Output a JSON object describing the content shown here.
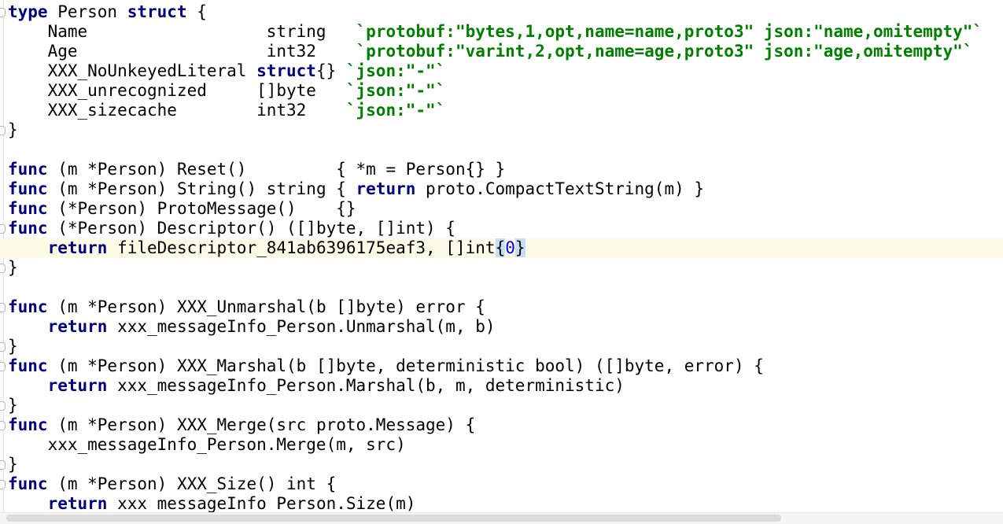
{
  "lines": [
    [
      {
        "t": "type",
        "c": "kw"
      },
      {
        "t": " Person "
      },
      {
        "t": "struct",
        "c": "kw"
      },
      {
        "t": " {"
      }
    ],
    [
      {
        "t": "    Name                  string   "
      },
      {
        "t": "`protobuf:\"bytes,1,opt,name=name,proto3\" json:\"name,omitempty\"`",
        "c": "str"
      }
    ],
    [
      {
        "t": "    Age                   int32    "
      },
      {
        "t": "`protobuf:\"varint,2,opt,name=age,proto3\" json:\"age,omitempty\"`",
        "c": "str"
      }
    ],
    [
      {
        "t": "    XXX_NoUnkeyedLiteral "
      },
      {
        "t": "struct",
        "c": "kw"
      },
      {
        "t": "{} "
      },
      {
        "t": "`json:\"-\"`",
        "c": "str"
      }
    ],
    [
      {
        "t": "    XXX_unrecognized     []byte   "
      },
      {
        "t": "`json:\"-\"`",
        "c": "str"
      }
    ],
    [
      {
        "t": "    XXX_sizecache        int32    "
      },
      {
        "t": "`json:\"-\"`",
        "c": "str"
      }
    ],
    [
      {
        "t": "}"
      }
    ],
    [],
    [
      {
        "t": "func",
        "c": "kw"
      },
      {
        "t": " (m *Person) Reset()         { *m = Person{} }"
      }
    ],
    [
      {
        "t": "func",
        "c": "kw"
      },
      {
        "t": " (m *Person) String() string { "
      },
      {
        "t": "return",
        "c": "kw"
      },
      {
        "t": " proto.CompactTextString(m) }"
      }
    ],
    [
      {
        "t": "func",
        "c": "kw"
      },
      {
        "t": " (*Person) ProtoMessage()    {}"
      }
    ],
    [
      {
        "t": "func",
        "c": "kw"
      },
      {
        "t": " (*Person) Descriptor() ([]byte, []int) {"
      }
    ],
    [
      {
        "t": "    "
      },
      {
        "t": "return",
        "c": "kw"
      },
      {
        "t": " fileDescriptor_841ab6396175eaf3, []int"
      },
      {
        "t": "{",
        "c": "brace-match"
      },
      {
        "t": "0",
        "c": "num"
      },
      {
        "t": "}",
        "c": "brace-match"
      }
    ],
    [
      {
        "t": "}"
      }
    ],
    [],
    [
      {
        "t": "func",
        "c": "kw"
      },
      {
        "t": " (m *Person) XXX_Unmarshal(b []byte) error {"
      }
    ],
    [
      {
        "t": "    "
      },
      {
        "t": "return",
        "c": "kw"
      },
      {
        "t": " xxx_messageInfo_Person.Unmarshal(m, b)"
      }
    ],
    [
      {
        "t": "}"
      }
    ],
    [
      {
        "t": "func",
        "c": "kw"
      },
      {
        "t": " (m *Person) XXX_Marshal(b []byte, deterministic bool) ([]byte, error) {"
      }
    ],
    [
      {
        "t": "    "
      },
      {
        "t": "return",
        "c": "kw"
      },
      {
        "t": " xxx_messageInfo_Person.Marshal(b, m, deterministic)"
      }
    ],
    [
      {
        "t": "}"
      }
    ],
    [
      {
        "t": "func",
        "c": "kw"
      },
      {
        "t": " (m *Person) XXX_Merge(src proto.Message) {"
      }
    ],
    [
      {
        "t": "    xxx_messageInfo_Person.Merge(m, src)"
      }
    ],
    [
      {
        "t": "}"
      }
    ],
    [
      {
        "t": "func",
        "c": "kw"
      },
      {
        "t": " (m *Person) XXX_Size() int {"
      }
    ],
    [
      {
        "t": "    "
      },
      {
        "t": "return",
        "c": "kw"
      },
      {
        "t": " xxx_messageInfo_Person.Size(m)"
      }
    ],
    [
      {
        "t": "}"
      }
    ]
  ],
  "current_line": 12,
  "fold_lines": [
    0,
    6,
    11,
    13,
    15,
    17,
    18,
    20,
    21,
    23,
    24,
    26
  ],
  "colors": {
    "keyword": "#000080",
    "string": "#008000",
    "number": "#0000ff",
    "current_line": "#fdfbe6",
    "brace_match": "#c3def7"
  }
}
